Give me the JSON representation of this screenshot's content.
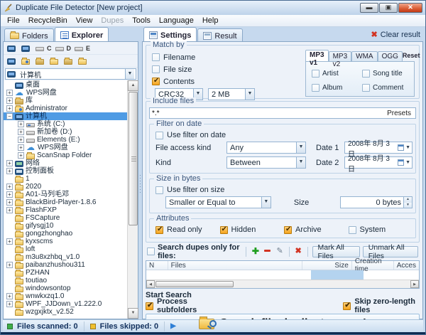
{
  "window": {
    "title": "Duplicate File Detector [New project]",
    "menus": [
      {
        "label": "File",
        "disabled": false
      },
      {
        "label": "RecycleBin",
        "disabled": false
      },
      {
        "label": "View",
        "disabled": false
      },
      {
        "label": "Dupes",
        "disabled": true
      },
      {
        "label": "Tools",
        "disabled": false
      },
      {
        "label": "Language",
        "disabled": false
      },
      {
        "label": "Help",
        "disabled": false
      }
    ]
  },
  "left": {
    "tabs": [
      {
        "label": "Folders",
        "active": false
      },
      {
        "label": "Explorer",
        "active": true
      }
    ],
    "drives": [
      "C",
      "D",
      "E"
    ],
    "location": "计算机",
    "tree": [
      {
        "label": "桌面",
        "level": 0,
        "expander": null,
        "icon": "desktop",
        "selected": false
      },
      {
        "label": "WPS网盘",
        "level": 0,
        "expander": "+",
        "icon": "cloud",
        "selected": false
      },
      {
        "label": "库",
        "level": 0,
        "expander": "+",
        "icon": "library",
        "selected": false
      },
      {
        "label": "Administrator",
        "level": 0,
        "expander": "+",
        "icon": "user",
        "selected": false
      },
      {
        "label": "计算机",
        "level": 0,
        "expander": "-",
        "icon": "computer",
        "selected": true
      },
      {
        "label": "系统 (C:)",
        "level": 1,
        "expander": "+",
        "icon": "drive-sys",
        "selected": false
      },
      {
        "label": "新加卷 (D:)",
        "level": 1,
        "expander": "+",
        "icon": "drive",
        "selected": false
      },
      {
        "label": "Elements (E:)",
        "level": 1,
        "expander": "+",
        "icon": "drive",
        "selected": false
      },
      {
        "label": "WPS网盘",
        "level": 1,
        "expander": "+",
        "icon": "cloud",
        "selected": false
      },
      {
        "label": "ScanSnap Folder",
        "level": 1,
        "expander": "+",
        "icon": "folder",
        "selected": false
      },
      {
        "label": "网络",
        "level": 0,
        "expander": "+",
        "icon": "network",
        "selected": false
      },
      {
        "label": "控制面板",
        "level": 0,
        "expander": "+",
        "icon": "control",
        "selected": false
      },
      {
        "label": "1",
        "level": 0,
        "expander": null,
        "icon": "folder",
        "selected": false
      },
      {
        "label": "2020",
        "level": 0,
        "expander": "+",
        "icon": "folder",
        "selected": false
      },
      {
        "label": "A01-马列毛邓",
        "level": 0,
        "expander": "+",
        "icon": "folder",
        "selected": false
      },
      {
        "label": "BlackBird-Player-1.8.6",
        "level": 0,
        "expander": "+",
        "icon": "folder",
        "selected": false
      },
      {
        "label": "FlashFXP",
        "level": 0,
        "expander": "+",
        "icon": "folder",
        "selected": false
      },
      {
        "label": "FSCapture",
        "level": 0,
        "expander": null,
        "icon": "folder",
        "selected": false
      },
      {
        "label": "gifysgj10",
        "level": 0,
        "expander": null,
        "icon": "folder",
        "selected": false
      },
      {
        "label": "gongzhonghao",
        "level": 0,
        "expander": null,
        "icon": "folder",
        "selected": false
      },
      {
        "label": "kyxscms",
        "level": 0,
        "expander": "+",
        "icon": "folder",
        "selected": false
      },
      {
        "label": "loft",
        "level": 0,
        "expander": null,
        "icon": "folder",
        "selected": false
      },
      {
        "label": "m3u8xzhbq_v1.0",
        "level": 0,
        "expander": null,
        "icon": "folder",
        "selected": false
      },
      {
        "label": "paibanzhushou311",
        "level": 0,
        "expander": "+",
        "icon": "folder",
        "selected": false
      },
      {
        "label": "PZHAN",
        "level": 0,
        "expander": null,
        "icon": "folder",
        "selected": false
      },
      {
        "label": "toutiao",
        "level": 0,
        "expander": null,
        "icon": "folder",
        "selected": false
      },
      {
        "label": "windowsontop",
        "level": 0,
        "expander": null,
        "icon": "folder",
        "selected": false
      },
      {
        "label": "wnwkxzq1.0",
        "level": 0,
        "expander": "+",
        "icon": "folder",
        "selected": false
      },
      {
        "label": "WPF_JJDown_v1.222.0",
        "level": 0,
        "expander": "+",
        "icon": "folder",
        "selected": false
      },
      {
        "label": "wzgxjktx_v2.52",
        "level": 0,
        "expander": null,
        "icon": "folder",
        "selected": false
      }
    ]
  },
  "right": {
    "tabs": [
      {
        "label": "Settings",
        "active": true
      },
      {
        "label": "Result",
        "active": false
      }
    ],
    "clear_result": "Clear result",
    "match_by": {
      "title": "Match by",
      "options": [
        {
          "label": "Filename",
          "checked": false
        },
        {
          "label": "File size",
          "checked": false
        },
        {
          "label": "Contents",
          "checked": true
        }
      ],
      "method": "CRC32",
      "block_size": "2 MB"
    },
    "audio_tags": {
      "tabs": [
        "MP3 v1",
        "MP3 v2",
        "WMA",
        "OGG"
      ],
      "active_tab": "MP3 v1",
      "reset": "Reset",
      "options": [
        {
          "label": "Artist",
          "checked": false
        },
        {
          "label": "Song title",
          "checked": false
        },
        {
          "label": "Album",
          "checked": false
        },
        {
          "label": "Comment",
          "checked": false
        }
      ]
    },
    "include_files": {
      "title": "Include files",
      "pattern": "*.*",
      "presets": "Presets",
      "filter_date": {
        "title": "Filter on date",
        "use": {
          "label": "Use filter on date",
          "checked": false
        },
        "row1": {
          "label": "File access kind",
          "value": "Any",
          "date_label": "Date 1",
          "date": "2008年 8月 3日"
        },
        "row2": {
          "label": "Kind",
          "value": "Between",
          "date_label": "Date 2",
          "date": "2008年 8月 3日"
        }
      },
      "size_bytes": {
        "title": "Size in bytes",
        "use": {
          "label": "Use filter on size",
          "checked": false
        },
        "comparator": "Smaller or Equal to",
        "size_label": "Size",
        "size_value": "0 bytes"
      },
      "attributes": {
        "title": "Attributes",
        "options": [
          {
            "label": "Read only",
            "checked": true
          },
          {
            "label": "Hidden",
            "checked": true
          },
          {
            "label": "Archive",
            "checked": true
          },
          {
            "label": "System",
            "checked": false
          }
        ]
      }
    },
    "dupes_bar": {
      "label": "Search dupes only for files:",
      "checked": false,
      "mark_all": "Mark All Files",
      "unmark_all": "Unmark All Files"
    },
    "table": {
      "headers": [
        "N",
        "Files",
        "Size",
        "Creation time",
        "Acces"
      ]
    },
    "start_search": {
      "title": "Start Search",
      "options": [
        {
          "label": "Process subfolders",
          "checked": true
        },
        {
          "label": "Skip zero-length files",
          "checked": true
        }
      ],
      "button": "Search file duplicates now!"
    }
  },
  "statusbar": {
    "scanned": "Files scanned: 0",
    "skipped": "Files skipped: 0"
  }
}
